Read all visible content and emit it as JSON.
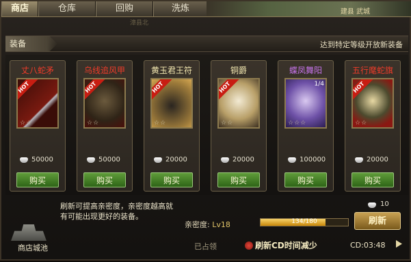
{
  "tabs": [
    {
      "label": "商店",
      "active": true
    },
    {
      "label": "仓库",
      "active": false
    },
    {
      "label": "回购",
      "active": false
    },
    {
      "label": "洗炼",
      "active": false
    }
  ],
  "map": {
    "label": "建县 武城",
    "sublabel": "漳县北"
  },
  "category": {
    "label": "装备",
    "note": "达到特定等级开放新装备"
  },
  "items": [
    {
      "name": "丈八蛇矛",
      "color": "red",
      "price": "50000",
      "hot": true,
      "stars": "☆☆",
      "icon": "spear-icon",
      "buy_label": "购买"
    },
    {
      "name": "乌线追风甲",
      "color": "red",
      "price": "50000",
      "hot": true,
      "stars": "☆☆",
      "icon": "armor-icon",
      "buy_label": "购买"
    },
    {
      "name": "黄玉君王符",
      "color": "gold",
      "price": "20000",
      "hot": true,
      "stars": "☆☆",
      "icon": "tiger-icon",
      "buy_label": "购买"
    },
    {
      "name": "铜爵",
      "color": "gold",
      "price": "20000",
      "hot": true,
      "stars": "☆☆",
      "icon": "horse-icon",
      "buy_label": "购买"
    },
    {
      "name": "蝶凤舞阳",
      "color": "purple",
      "price": "100000",
      "hot": false,
      "stars": "☆☆☆",
      "icon": "robe-icon",
      "badge": "1/4",
      "buy_label": "购买"
    },
    {
      "name": "五行麾蛇旗",
      "color": "red",
      "price": "20000",
      "hot": true,
      "stars": "☆☆",
      "icon": "flag-icon",
      "buy_label": "购买"
    }
  ],
  "hot_label": "HOT",
  "bottom": {
    "tip": "刷新可提高亲密度，亲密度越高就有可能出现更好的装备。",
    "intimacy_label": "亲密度:",
    "intimacy_level": "Lv18",
    "progress_text": "134/180",
    "progress_value": 134,
    "progress_max": 180,
    "refresh_cost": "10",
    "refresh_label": "刷新",
    "location_label": "商店城池",
    "status_text": "已占领",
    "cd_refresh_label": "刷新CD时间减少",
    "cd_text": "CD:03:48"
  },
  "colors": {
    "red": "#ef3c2a",
    "gold": "#f2e7b0",
    "purple": "#c774ec",
    "buy_green": "#3f7f22",
    "refresh_gold": "#a47e32"
  }
}
